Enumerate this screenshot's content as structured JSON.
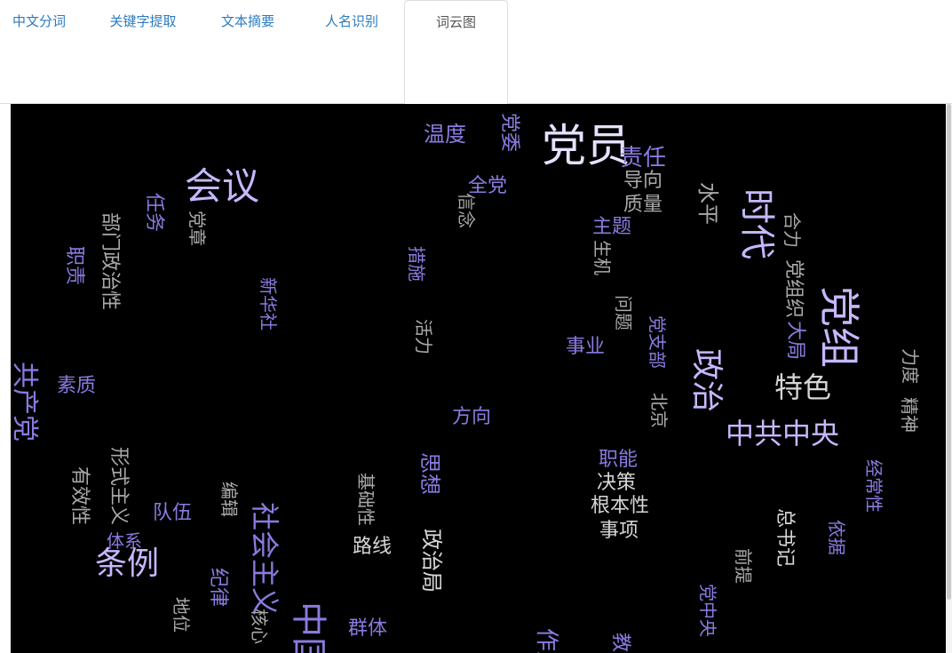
{
  "tabs": [
    {
      "label": "中文分词",
      "active": false
    },
    {
      "label": "关键字提取",
      "active": false
    },
    {
      "label": "文本摘要",
      "active": false
    },
    {
      "label": "人名识别",
      "active": false
    },
    {
      "label": "词云图",
      "active": true
    }
  ],
  "colors": {
    "tab_link": "#2b7bbf",
    "tab_active": "#555555",
    "cloud_background": "#000000",
    "word_palette": [
      "#ffffff",
      "#d6ccff",
      "#9f8ee6",
      "#6c5fc7",
      "#a9a9a9"
    ]
  },
  "wordcloud": {
    "words": [
      {
        "text": "党员",
        "color": "#e6e0ff"
      },
      {
        "text": "会议",
        "color": "#c7b7ff"
      },
      {
        "text": "党组",
        "color": "#c7b7ff"
      },
      {
        "text": "中共中央",
        "color": "#c7b7ff"
      },
      {
        "text": "时代",
        "color": "#c7b7ff"
      },
      {
        "text": "特色",
        "color": "#d6d6d6"
      },
      {
        "text": "政治",
        "color": "#c7b7ff"
      },
      {
        "text": "条例",
        "color": "#c7b7ff"
      },
      {
        "text": "社会主义",
        "color": "#8b7ae0"
      },
      {
        "text": "中国",
        "color": "#8b7ae0"
      },
      {
        "text": "共产党",
        "color": "#8b7ae0"
      },
      {
        "text": "温度",
        "color": "#8b7ae0"
      },
      {
        "text": "党委",
        "color": "#8b7ae0"
      },
      {
        "text": "责任",
        "color": "#8b7ae0"
      },
      {
        "text": "全党",
        "color": "#8b7ae0"
      },
      {
        "text": "导向",
        "color": "#a9a9a9"
      },
      {
        "text": "质量",
        "color": "#a9a9a9"
      },
      {
        "text": "水平",
        "color": "#a9a9a9"
      },
      {
        "text": "主题",
        "color": "#8b7ae0"
      },
      {
        "text": "信念",
        "color": "#a9a9a9"
      },
      {
        "text": "党章",
        "color": "#a9a9a9"
      },
      {
        "text": "任务",
        "color": "#8b7ae0"
      },
      {
        "text": "部门政治性",
        "color": "#a9a9a9"
      },
      {
        "text": "职责",
        "color": "#8b7ae0"
      },
      {
        "text": "新华社",
        "color": "#8b7ae0"
      },
      {
        "text": "措施",
        "color": "#8b7ae0"
      },
      {
        "text": "活力",
        "color": "#a9a9a9"
      },
      {
        "text": "生机",
        "color": "#a9a9a9"
      },
      {
        "text": "问题",
        "color": "#a9a9a9"
      },
      {
        "text": "事业",
        "color": "#8b7ae0"
      },
      {
        "text": "党支部",
        "color": "#8b7ae0"
      },
      {
        "text": "合力",
        "color": "#a9a9a9"
      },
      {
        "text": "党组织",
        "color": "#a9a9a9"
      },
      {
        "text": "大局",
        "color": "#8b7ae0"
      },
      {
        "text": "力度",
        "color": "#a9a9a9"
      },
      {
        "text": "精神",
        "color": "#a9a9a9"
      },
      {
        "text": "素质",
        "color": "#8b7ae0"
      },
      {
        "text": "方向",
        "color": "#8b7ae0"
      },
      {
        "text": "北京",
        "color": "#a9a9a9"
      },
      {
        "text": "职能",
        "color": "#8b7ae0"
      },
      {
        "text": "决策",
        "color": "#d6d6d6"
      },
      {
        "text": "根本性",
        "color": "#d6d6d6"
      },
      {
        "text": "事项",
        "color": "#d6d6d6"
      },
      {
        "text": "思想",
        "color": "#8b7ae0"
      },
      {
        "text": "基础性",
        "color": "#a9a9a9"
      },
      {
        "text": "路线",
        "color": "#d6d6d6"
      },
      {
        "text": "政治局",
        "color": "#d6d6d6"
      },
      {
        "text": "形式主义",
        "color": "#a9a9a9"
      },
      {
        "text": "有效性",
        "color": "#a9a9a9"
      },
      {
        "text": "队伍",
        "color": "#8b7ae0"
      },
      {
        "text": "体系",
        "color": "#8b7ae0"
      },
      {
        "text": "编辑",
        "color": "#a9a9a9"
      },
      {
        "text": "经常性",
        "color": "#8b7ae0"
      },
      {
        "text": "总书记",
        "color": "#d6d6d6"
      },
      {
        "text": "依据",
        "color": "#8b7ae0"
      },
      {
        "text": "前提",
        "color": "#a9a9a9"
      },
      {
        "text": "党中央",
        "color": "#8b7ae0"
      },
      {
        "text": "纪律",
        "color": "#8b7ae0"
      },
      {
        "text": "地位",
        "color": "#a9a9a9"
      },
      {
        "text": "核心",
        "color": "#a9a9a9"
      },
      {
        "text": "群体",
        "color": "#8b7ae0"
      },
      {
        "text": "作用",
        "color": "#8b7ae0"
      },
      {
        "text": "教育",
        "color": "#8b7ae0"
      }
    ]
  }
}
